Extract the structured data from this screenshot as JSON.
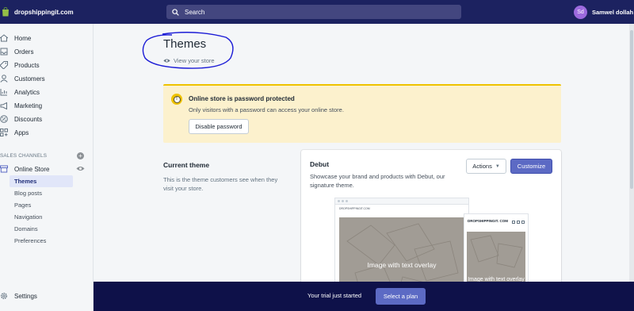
{
  "topbar": {
    "store_name": "dropshippingit.com",
    "search_placeholder": "Search",
    "user_initials": "Sd",
    "user_name": "Samwel dollah"
  },
  "sidebar": {
    "items": [
      {
        "label": "Home",
        "icon": "home-icon"
      },
      {
        "label": "Orders",
        "icon": "orders-icon"
      },
      {
        "label": "Products",
        "icon": "tag-icon"
      },
      {
        "label": "Customers",
        "icon": "person-icon"
      },
      {
        "label": "Analytics",
        "icon": "bar-chart-icon"
      },
      {
        "label": "Marketing",
        "icon": "megaphone-icon"
      },
      {
        "label": "Discounts",
        "icon": "discount-icon"
      },
      {
        "label": "Apps",
        "icon": "apps-icon"
      }
    ],
    "sales_channels_label": "SALES CHANNELS",
    "online_store_label": "Online Store",
    "online_store_sub": [
      "Themes",
      "Blog posts",
      "Pages",
      "Navigation",
      "Domains",
      "Preferences"
    ],
    "active_sub": "Themes",
    "settings_label": "Settings"
  },
  "main": {
    "title": "Themes",
    "view_store": "View your store",
    "banner": {
      "title": "Online store is password protected",
      "text": "Only visitors with a password can access your online store.",
      "button": "Disable password"
    },
    "current_theme": {
      "heading": "Current theme",
      "description": "This is the theme customers see when they visit your store."
    },
    "theme_card": {
      "name": "Debut",
      "description": "Showcase your brand and products with Debut, our signature theme.",
      "actions_label": "Actions",
      "customize_label": "Customize",
      "preview_overlay_desktop": "Image with text overlay",
      "preview_overlay_mobile": "Image with text overlay",
      "preview_brand": "DROPSHIPPINGIT.COM",
      "preview_mobile_brand": "DROPSHIPPINGIT. COM"
    }
  },
  "trial": {
    "text": "Your trial just started",
    "button": "Select a plan"
  },
  "colors": {
    "topbar": "#1c2260",
    "accent": "#5c6ac4",
    "banner": "#fcf1cd",
    "trialbar": "#0e1149"
  }
}
